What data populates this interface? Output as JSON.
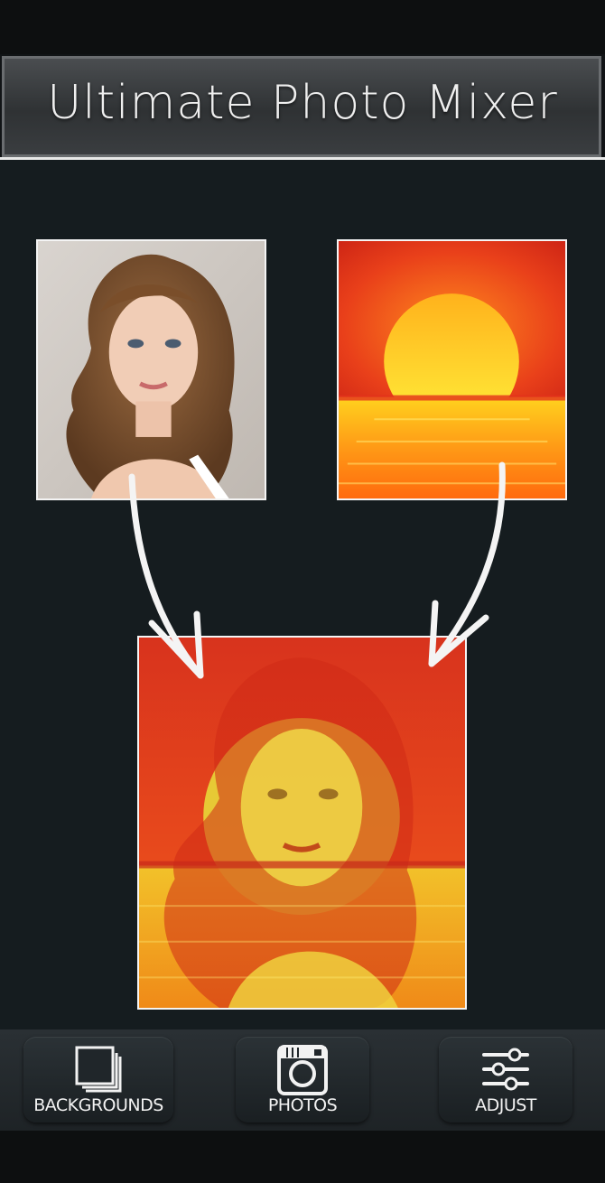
{
  "header": {
    "title": "Ultimate Photo Mixer"
  },
  "images": {
    "portrait": "portrait-thumbnail",
    "sunset": "sunset-thumbnail",
    "result": "blended-result"
  },
  "nav": {
    "backgrounds_label": "BACKGROUNDS",
    "photos_label": "PHOTOS",
    "adjust_label": "ADJUST"
  },
  "colors": {
    "header_bg": "#3a3d40",
    "canvas_bg": "#151c1f",
    "sun_red": "#e4321b",
    "sun_yellow": "#ffe23a",
    "text": "#efefef"
  },
  "icons": [
    "backgrounds-stack-icon",
    "camera-icon",
    "sliders-icon",
    "arrow-icon"
  ]
}
